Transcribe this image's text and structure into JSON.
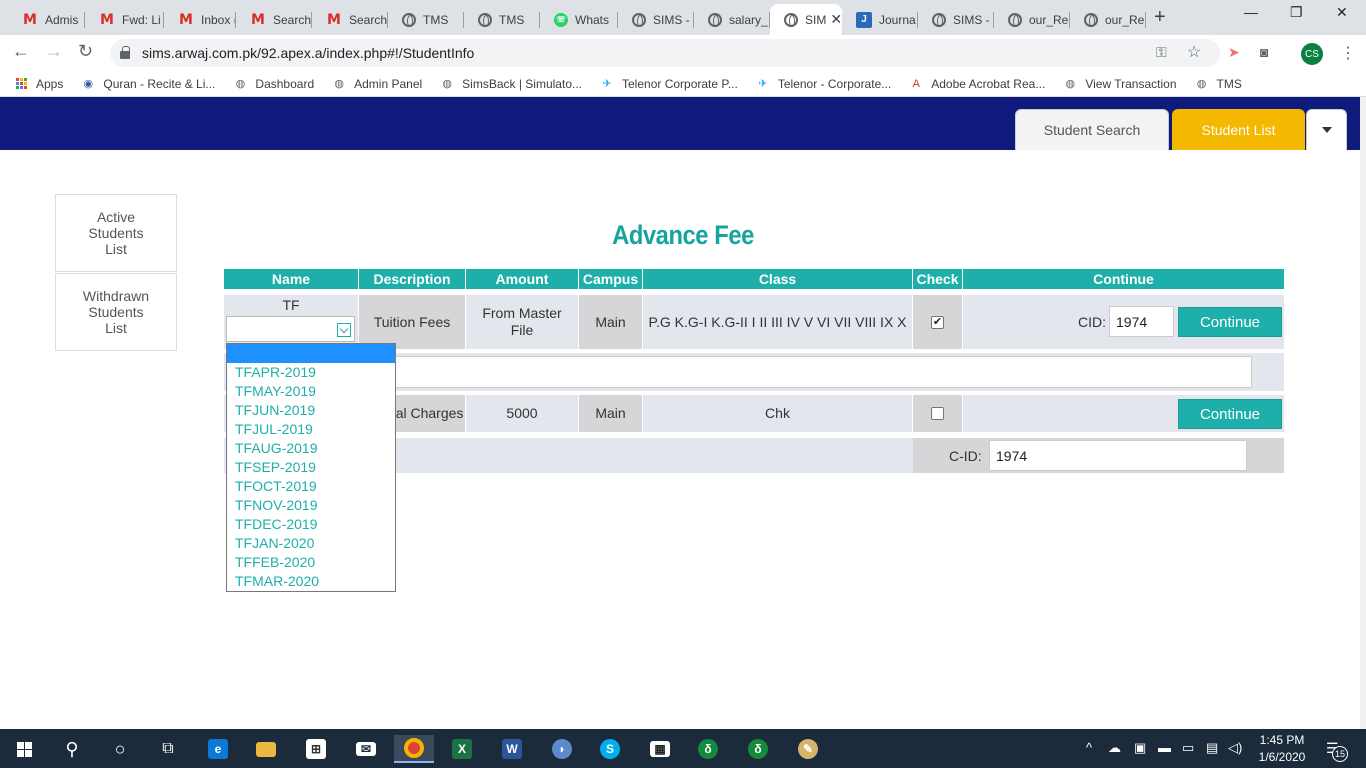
{
  "browser": {
    "tabs": [
      {
        "title": "Admis",
        "icon": "gmail-icon"
      },
      {
        "title": "Fwd: Li",
        "icon": "gmail-icon"
      },
      {
        "title": "Inbox (",
        "icon": "gmail-icon"
      },
      {
        "title": "Search",
        "icon": "gmail-icon"
      },
      {
        "title": "Search",
        "icon": "gmail-icon"
      },
      {
        "title": "TMS",
        "icon": "globe-icon"
      },
      {
        "title": "TMS",
        "icon": "globe-icon"
      },
      {
        "title": "Whats",
        "icon": "whatsapp-icon"
      },
      {
        "title": "SIMS -",
        "icon": "globe-icon"
      },
      {
        "title": "salary_",
        "icon": "globe-icon"
      },
      {
        "title": "SIM",
        "icon": "globe-icon",
        "active": true
      },
      {
        "title": "Journa",
        "icon": "journal-icon"
      },
      {
        "title": "SIMS -",
        "icon": "globe-icon"
      },
      {
        "title": "our_Re",
        "icon": "globe-icon"
      },
      {
        "title": "our_Re",
        "icon": "globe-icon"
      }
    ],
    "tab_close": "✕",
    "new_tab": "+",
    "window_controls": {
      "minimize": "—",
      "maximize": "❐",
      "close": "✕"
    },
    "url": "sims.arwaj.com.pk/92.apex.a/index.php#!/StudentInfo",
    "profile_initials": "CS",
    "bookmarks": [
      {
        "label": "Apps",
        "icon": "apps-grid-icon"
      },
      {
        "label": "Quran - Recite & Li...",
        "icon": "quran-icon"
      },
      {
        "label": "Dashboard",
        "icon": "globe-icon"
      },
      {
        "label": "Admin Panel",
        "icon": "globe-icon"
      },
      {
        "label": "SimsBack | Simulato...",
        "icon": "globe-icon"
      },
      {
        "label": "Telenor Corporate P...",
        "icon": "telenor-icon"
      },
      {
        "label": "Telenor - Corporate...",
        "icon": "telenor-icon"
      },
      {
        "label": "Adobe Acrobat Rea...",
        "icon": "adobe-icon"
      },
      {
        "label": "View Transaction",
        "icon": "globe-icon"
      },
      {
        "label": "TMS",
        "icon": "globe-icon"
      }
    ]
  },
  "app": {
    "nav_tabs": {
      "student_search": "Student Search",
      "student_list": "Student List"
    },
    "sidebar": {
      "active_students": "Active Students List",
      "withdrawn_students": "Withdrawn Students List"
    },
    "title": "Advance Fee",
    "table": {
      "headers": [
        "Name",
        "Description",
        "Amount",
        "Campus",
        "Class",
        "Check",
        "Continue"
      ],
      "row1": {
        "name": "TF",
        "description": "Tuition Fees",
        "amount": "From Master File",
        "campus": "Main",
        "class": "P.G K.G-I K.G-II I II III IV V VI VII VIII IX X",
        "checked": true,
        "cid_label": "CID:",
        "cid_value": "1974",
        "continue_label": "Continue"
      },
      "row2": {
        "description_visible": "Annual Charges",
        "amount": "5000",
        "campus": "Main",
        "class": "Chk",
        "checked": false,
        "continue_label": "Continue",
        "cid_label": "C-ID:",
        "cid_value": "1974"
      }
    },
    "dropdown_options": [
      "TFAPR-2019",
      "TFMAY-2019",
      "TFJUN-2019",
      "TFJUL-2019",
      "TFAUG-2019",
      "TFSEP-2019",
      "TFOCT-2019",
      "TFNOV-2019",
      "TFDEC-2019",
      "TFJAN-2020",
      "TFFEB-2020",
      "TFMAR-2020"
    ],
    "accent_color": "#1eafaa",
    "header_color": "#0e1a7c",
    "active_tab_color": "#f5b800"
  },
  "taskbar": {
    "time": "1:45 PM",
    "date": "1/6/2020",
    "notifications": "15"
  }
}
